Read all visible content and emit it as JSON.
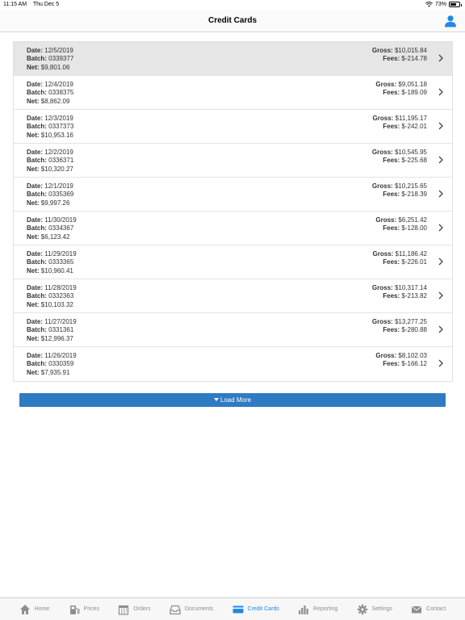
{
  "status": {
    "time": "11:15 AM",
    "date": "Thu Dec 5",
    "battery": "73%",
    "battery_level": 0.73
  },
  "header": {
    "title": "Credit Cards"
  },
  "labels": {
    "date": "Date:",
    "batch": "Batch:",
    "net": "Net:",
    "gross": "Gross:",
    "fees": "Fees:"
  },
  "rows": [
    {
      "date": "12/5/2019",
      "batch": "0339377",
      "net": "$9,801.06",
      "gross": "$10,015.84",
      "fees": "$-214.78"
    },
    {
      "date": "12/4/2019",
      "batch": "0338375",
      "net": "$8,862.09",
      "gross": "$9,051.18",
      "fees": "$-189.09"
    },
    {
      "date": "12/3/2019",
      "batch": "0337373",
      "net": "$10,953.16",
      "gross": "$11,195.17",
      "fees": "$-242.01"
    },
    {
      "date": "12/2/2019",
      "batch": "0336371",
      "net": "$10,320.27",
      "gross": "$10,545.95",
      "fees": "$-225.68"
    },
    {
      "date": "12/1/2019",
      "batch": "0335369",
      "net": "$9,997.26",
      "gross": "$10,215.65",
      "fees": "$-218.39"
    },
    {
      "date": "11/30/2019",
      "batch": "0334367",
      "net": "$6,123.42",
      "gross": "$6,251.42",
      "fees": "$-128.00"
    },
    {
      "date": "11/29/2019",
      "batch": "0333365",
      "net": "$10,960.41",
      "gross": "$11,186.42",
      "fees": "$-226.01"
    },
    {
      "date": "11/28/2019",
      "batch": "0332363",
      "net": "$10,103.32",
      "gross": "$10,317.14",
      "fees": "$-213.82"
    },
    {
      "date": "11/27/2019",
      "batch": "0331361",
      "net": "$12,996.37",
      "gross": "$13,277.25",
      "fees": "$-280.88"
    },
    {
      "date": "11/26/2019",
      "batch": "0330359",
      "net": "$7,935.91",
      "gross": "$8,102.03",
      "fees": "$-166.12"
    }
  ],
  "load_more": {
    "label": "Load More"
  },
  "tabs": [
    {
      "label": "Home",
      "icon": "home-icon"
    },
    {
      "label": "Prices",
      "icon": "fuel-pump-icon"
    },
    {
      "label": "Orders",
      "icon": "calendar-icon"
    },
    {
      "label": "Documents",
      "icon": "inbox-icon"
    },
    {
      "label": "Credit Cards",
      "icon": "credit-card-icon",
      "active": true
    },
    {
      "label": "Reporting",
      "icon": "bar-chart-icon"
    },
    {
      "label": "Settings",
      "icon": "gear-icon"
    },
    {
      "label": "Contact",
      "icon": "envelope-icon"
    }
  ],
  "colors": {
    "accent": "#1e88e5",
    "button": "#2e7bc4",
    "selected_row": "#e6e6e6"
  }
}
